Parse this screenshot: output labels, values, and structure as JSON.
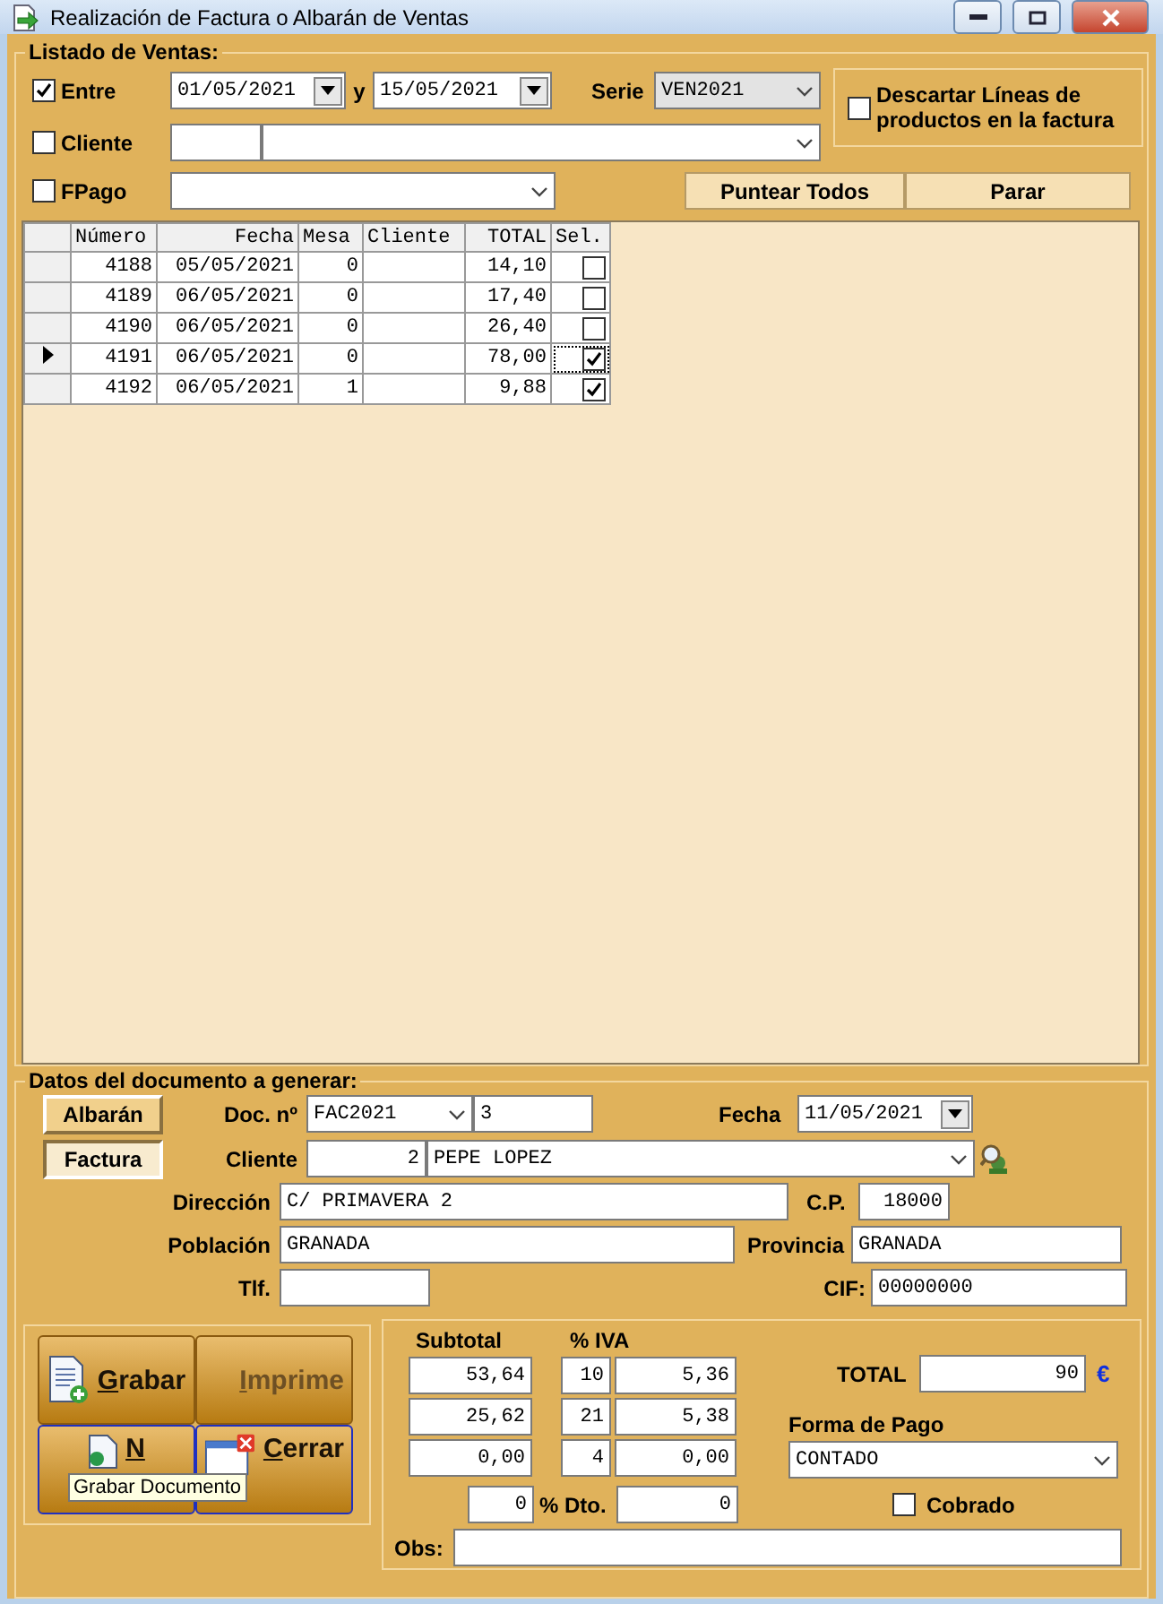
{
  "window": {
    "title": "Realización de Factura o Albarán de Ventas"
  },
  "listado": {
    "legend": "Listado de Ventas:",
    "entre": {
      "label": "Entre",
      "checked": true
    },
    "date_from": "01/05/2021",
    "and_label": "y",
    "date_to": "15/05/2021",
    "serie": {
      "label": "Serie",
      "value": "VEN2021",
      "disabled": true
    },
    "descartar": {
      "label": "Descartar Líneas de productos en  la factura",
      "checked": false
    },
    "cliente": {
      "label": "Cliente",
      "checked": false
    },
    "fpago": {
      "label": "FPago",
      "checked": false
    },
    "buttons": [
      "Puntear Todos",
      "Parar"
    ]
  },
  "table": {
    "columns": [
      "Número",
      "Fecha",
      "Mesa",
      "Cliente",
      "TOTAL",
      "Sel."
    ],
    "rows": [
      {
        "numero": "4188",
        "fecha": "05/05/2021",
        "mesa": "0",
        "total": "14,10",
        "checked": false,
        "current": false
      },
      {
        "numero": "4189",
        "fecha": "06/05/2021",
        "mesa": "0",
        "total": "17,40",
        "checked": false,
        "current": false
      },
      {
        "numero": "4190",
        "fecha": "06/05/2021",
        "mesa": "0",
        "total": "26,40",
        "checked": false,
        "current": false
      },
      {
        "numero": "4191",
        "fecha": "06/05/2021",
        "mesa": "0",
        "total": "78,00",
        "checked": true,
        "current": true
      },
      {
        "numero": "4192",
        "fecha": "06/05/2021",
        "mesa": "1",
        "total": "9,88",
        "checked": true,
        "current": false
      }
    ]
  },
  "documento": {
    "legend": "Datos del documento a generar:",
    "doc_types": [
      {
        "label": "Albarán",
        "selected": false
      },
      {
        "label": "Factura",
        "selected": true
      }
    ],
    "doc_label": "Doc. nº",
    "doc_serie": "FAC2021",
    "doc_num": "3",
    "fecha_label": "Fecha",
    "fecha": "11/05/2021",
    "cliente_label": "Cliente",
    "cliente_code": "2",
    "cliente_name": "PEPE LOPEZ",
    "direccion_label": "Dirección",
    "direccion": "C/ PRIMAVERA 2",
    "cp_label": "C.P.",
    "cp": "18000",
    "poblacion_label": "Población",
    "poblacion": "GRANADA",
    "provincia_label": "Provincia",
    "provincia": "GRANADA",
    "tlf_label": "Tlf.",
    "cif_label": "CIF:",
    "cif": "00000000"
  },
  "actions": [
    {
      "label": "Grabar",
      "kind": "save",
      "disabled": false
    },
    {
      "label": "Imprime",
      "kind": "print",
      "disabled": true
    },
    {
      "label": "N",
      "kind": "new",
      "disabled": false
    },
    {
      "label": "Cerrar",
      "kind": "close",
      "disabled": false
    }
  ],
  "tooltip": "Grabar Documento",
  "totals": {
    "subtotal_label": "Subtotal",
    "iva_label": "% IVA",
    "rows": [
      {
        "subtotal": "53,64",
        "rate": "10",
        "iva": "5,36"
      },
      {
        "subtotal": "25,62",
        "rate": "21",
        "iva": "5,38"
      },
      {
        "subtotal": "0,00",
        "rate": "4",
        "iva": "0,00"
      }
    ],
    "dto": "0",
    "dto_label": "% Dto.",
    "dto_amount": "0",
    "total_label": "TOTAL",
    "total": "90",
    "currency": "€",
    "forma_pago_label": "Forma de Pago",
    "forma_pago": "CONTADO",
    "cobrado": {
      "label": "Cobrado",
      "checked": false
    },
    "obs_label": "Obs:"
  }
}
